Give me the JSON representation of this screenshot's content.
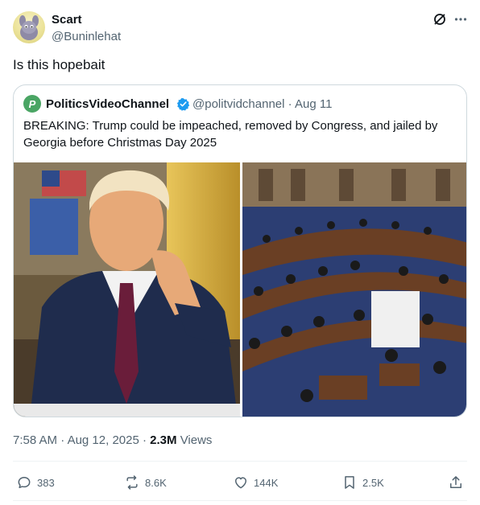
{
  "post": {
    "author_name": "Scart",
    "author_handle": "@Buninlehat",
    "text": "Is this hopebait"
  },
  "quote": {
    "avatar_letter": "P",
    "author_name": "PoliticsVideoChannel",
    "author_handle": "@politvidchannel",
    "date": "Aug 11",
    "text": "BREAKING: Trump could be impeached, removed by Congress, and jailed by Georgia before Christmas Day 2025"
  },
  "meta": {
    "time": "7:58 AM",
    "date": "Aug 12, 2025",
    "views_count": "2.3M",
    "views_label": "Views"
  },
  "actions": {
    "replies": "383",
    "reposts": "8.6K",
    "likes": "144K",
    "bookmarks": "2.5K"
  },
  "colors": {
    "text": "#0f1419",
    "secondary": "#536471",
    "border": "#cfd9de",
    "verified_blue": "#1d9bf0",
    "channel_green": "#4aa564"
  }
}
